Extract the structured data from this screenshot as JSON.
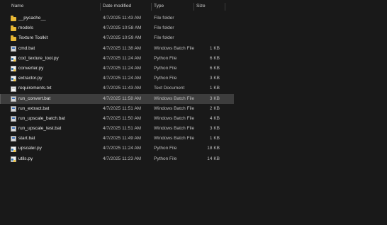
{
  "columns": {
    "name": "Name",
    "date": "Date modified",
    "type": "Type",
    "size": "Size"
  },
  "files": [
    {
      "name": "__pycache__",
      "date": "4/7/2025 11:43 AM",
      "type": "File folder",
      "size": "",
      "icon": "folder-icon"
    },
    {
      "name": "models",
      "date": "4/7/2025 10:58 AM",
      "type": "File folder",
      "size": "",
      "icon": "folder-icon"
    },
    {
      "name": "Texture Toolkit",
      "date": "4/7/2025 10:59 AM",
      "type": "File folder",
      "size": "",
      "icon": "folder-icon"
    },
    {
      "name": "cmd.bat",
      "date": "4/7/2025 11:38 AM",
      "type": "Windows Batch File",
      "size": "1 KB",
      "icon": "batch-file-icon"
    },
    {
      "name": "cod_texture_tool.py",
      "date": "4/7/2025 11:24 AM",
      "type": "Python File",
      "size": "6 KB",
      "icon": "python-file-icon"
    },
    {
      "name": "converter.py",
      "date": "4/7/2025 11:24 AM",
      "type": "Python File",
      "size": "6 KB",
      "icon": "python-file-icon"
    },
    {
      "name": "extractor.py",
      "date": "4/7/2025 11:24 AM",
      "type": "Python File",
      "size": "3 KB",
      "icon": "python-file-icon"
    },
    {
      "name": "requirements.txt",
      "date": "4/7/2025 11:43 AM",
      "type": "Text Document",
      "size": "1 KB",
      "icon": "text-file-icon"
    },
    {
      "name": "run_convert.bat",
      "date": "4/7/2025 11:58 AM",
      "type": "Windows Batch File",
      "size": "3 KB",
      "icon": "batch-file-icon",
      "selected": true
    },
    {
      "name": "run_extract.bat",
      "date": "4/7/2025 11:51 AM",
      "type": "Windows Batch File",
      "size": "2 KB",
      "icon": "batch-file-icon"
    },
    {
      "name": "run_upscale_batch.bat",
      "date": "4/7/2025 11:50 AM",
      "type": "Windows Batch File",
      "size": "4 KB",
      "icon": "batch-file-icon"
    },
    {
      "name": "run_upscale_test.bat",
      "date": "4/7/2025 11:51 AM",
      "type": "Windows Batch File",
      "size": "3 KB",
      "icon": "batch-file-icon"
    },
    {
      "name": "start.bat",
      "date": "4/7/2025 11:49 AM",
      "type": "Windows Batch File",
      "size": "1 KB",
      "icon": "batch-file-icon"
    },
    {
      "name": "upscaler.py",
      "date": "4/7/2025 11:24 AM",
      "type": "Python File",
      "size": "18 KB",
      "icon": "python-file-icon"
    },
    {
      "name": "utils.py",
      "date": "4/7/2025 11:23 AM",
      "type": "Python File",
      "size": "14 KB",
      "icon": "python-file-icon"
    }
  ]
}
